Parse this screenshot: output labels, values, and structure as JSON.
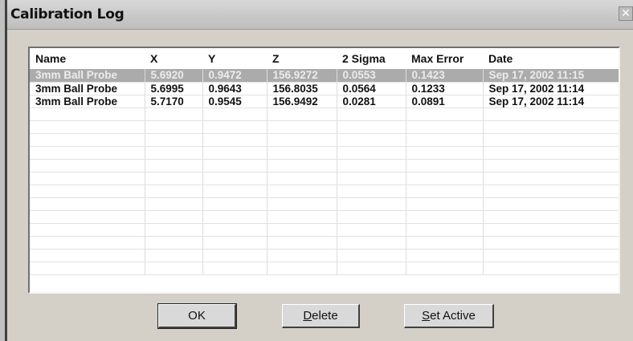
{
  "window": {
    "title": "Calibration Log",
    "close_glyph": "✕"
  },
  "table": {
    "columns": [
      "Name",
      "X",
      "Y",
      "Z",
      "2 Sigma",
      "Max Error",
      "Date"
    ],
    "rows": [
      [
        "3mm Ball Probe",
        "5.6920",
        "0.9472",
        "156.9272",
        "0.0553",
        "0.1423",
        "Sep 17, 2002 11:15"
      ],
      [
        "3mm Ball Probe",
        "5.6995",
        "0.9643",
        "156.8035",
        "0.0564",
        "0.1233",
        "Sep 17, 2002 11:14"
      ],
      [
        "3mm Ball Probe",
        "5.7170",
        "0.9545",
        "156.9492",
        "0.0281",
        "0.0891",
        "Sep 17, 2002 11:14"
      ]
    ],
    "selected_row": 0,
    "empty_rows": 13
  },
  "buttons": {
    "ok": "OK",
    "delete_first": "D",
    "delete_rest": "elete",
    "set_active_first": "S",
    "set_active_rest": "et Active"
  },
  "colors": {
    "dialog_bg": "#d4d0c8",
    "selection_bg": "#ababab",
    "selection_text": "#ececec"
  }
}
